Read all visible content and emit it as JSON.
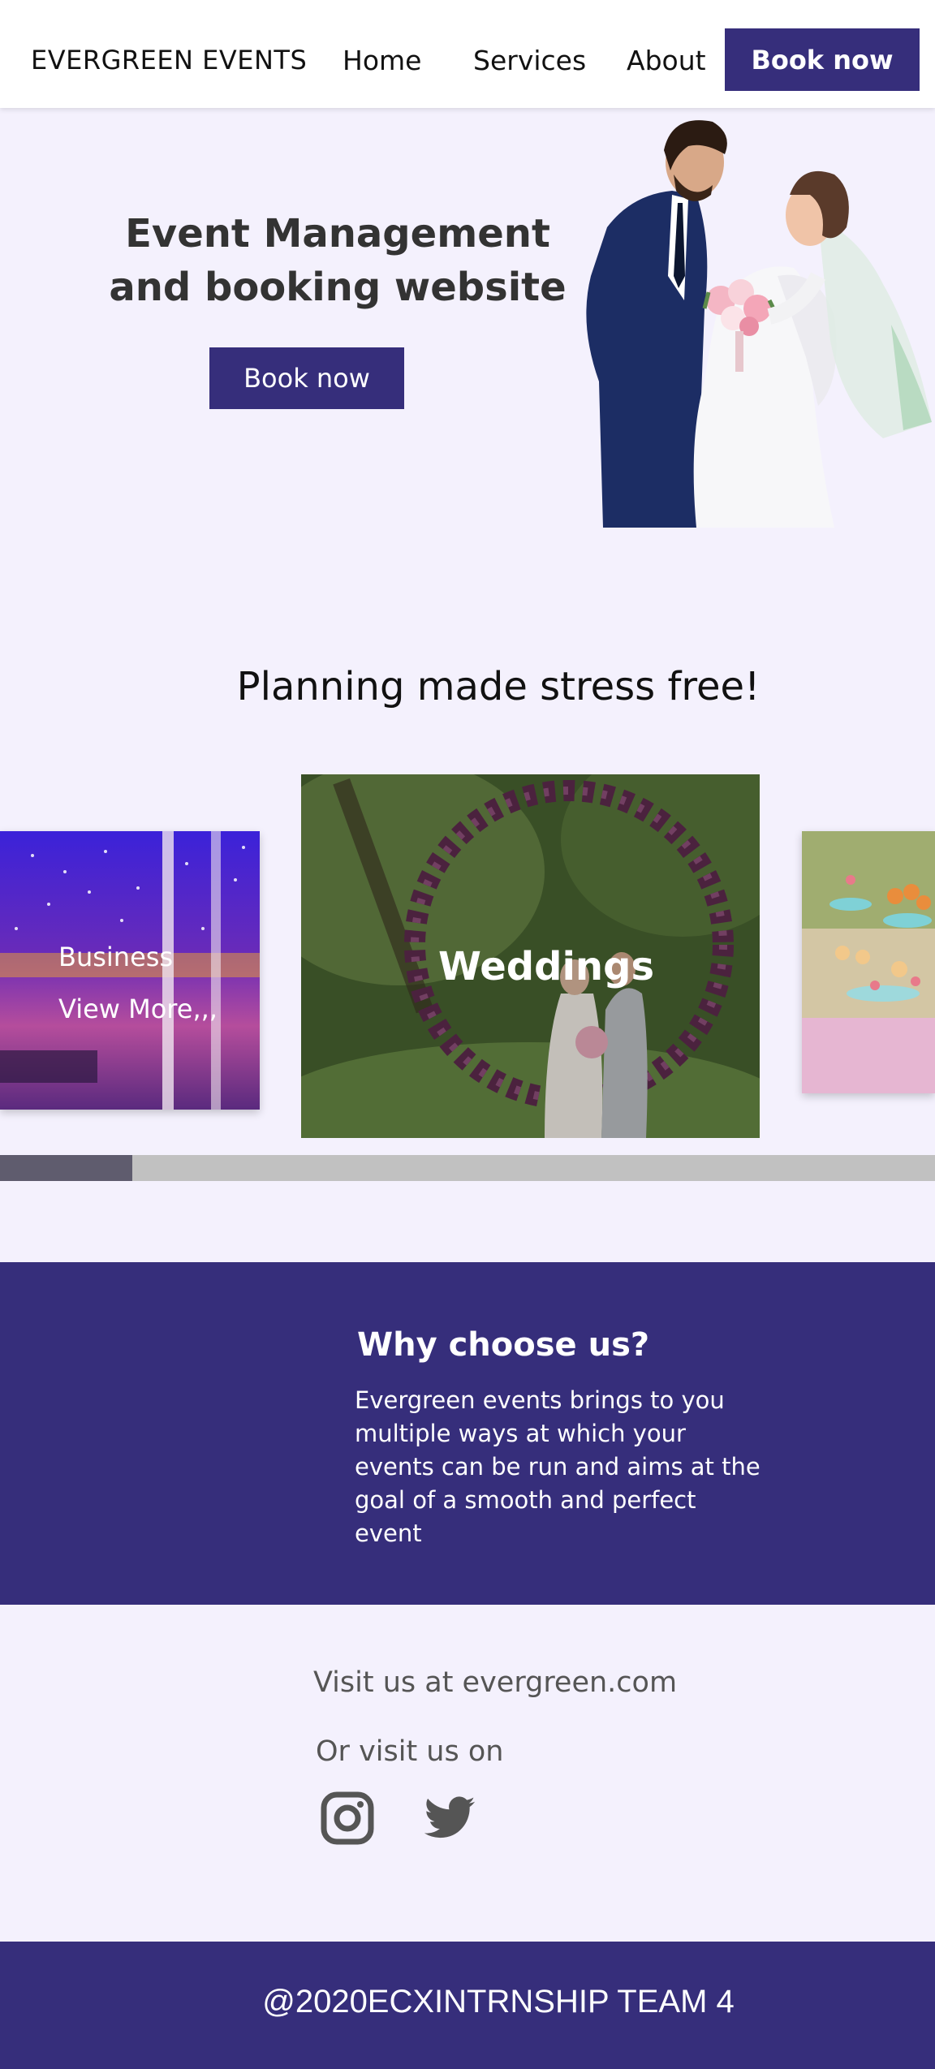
{
  "nav": {
    "brand": "EVERGREEN EVENTS",
    "links": [
      "Home",
      "Services",
      "About"
    ],
    "book_label": "Book now"
  },
  "hero": {
    "title": "Event Management and booking website",
    "book_label": "Book now",
    "image": "wedding-couple-photo"
  },
  "planning": {
    "title": "Planning made stress free!",
    "cards": [
      {
        "title": "Business",
        "link": "View More,,,",
        "image": "business-venue-lights-photo"
      },
      {
        "title": "Weddings",
        "image": "wedding-arch-photo"
      },
      {
        "image": "dessert-table-photo"
      }
    ]
  },
  "why": {
    "title": "Why choose us?",
    "text": "Evergreen events brings to you multiple ways at which your events can be run and aims at the goal of a smooth and perfect event"
  },
  "visit": {
    "line1": "Visit us at evergreen.com",
    "line2": "Or visit us on",
    "icons": [
      "instagram-icon",
      "twitter-icon"
    ]
  },
  "footer": {
    "text": "@2020ECXINTRNSHIP TEAM 4"
  },
  "colors": {
    "accent": "#362e7b",
    "background": "#f4f1fd",
    "scroll_track": "#c1c1c1",
    "scroll_thumb": "#5f5c6e"
  }
}
